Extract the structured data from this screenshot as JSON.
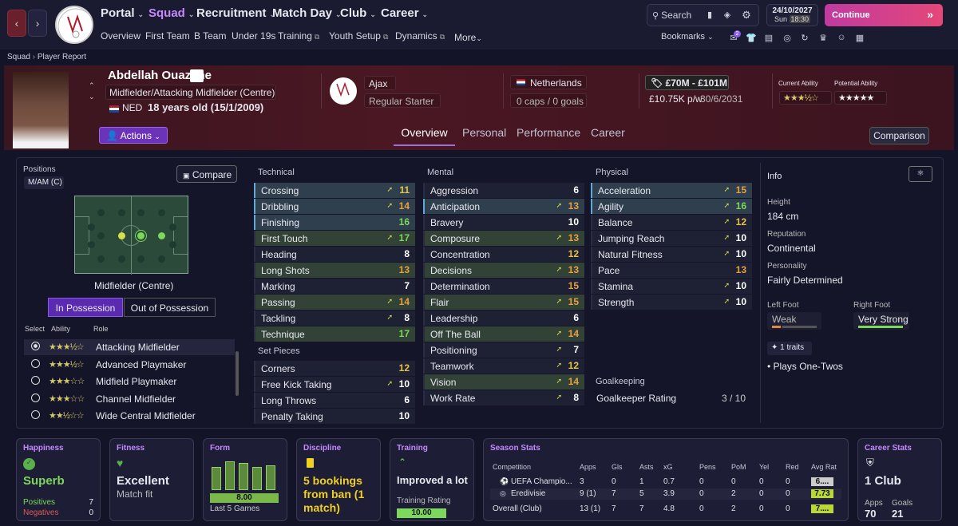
{
  "topbar": {
    "menus": [
      "Portal",
      "Squad",
      "Recruitment",
      "Match Day",
      "Club",
      "Career"
    ],
    "submenus": [
      "Overview",
      "First Team",
      "B Team",
      "Under 19s",
      "Training",
      "Youth Setup",
      "Dynamics",
      "More"
    ],
    "search": "Search",
    "date": "24/10/2027",
    "day_time": "Sun",
    "time": "18:30",
    "continue": "Continue",
    "bookmarks": "Bookmarks",
    "badge": "2"
  },
  "crumb": {
    "root": "Squad",
    "page": "Player Report"
  },
  "player": {
    "name": "Abdellah Ouazane",
    "position": "Midfielder/Attacking Midfielder (Centre)",
    "nation": "NED",
    "age": "18 years old (15/1/2009)",
    "club": "Ajax",
    "status": "Regular Starter",
    "country": "Netherlands",
    "caps": "0 caps / 0 goals",
    "value": "£70M - £101M",
    "wage": "£10.75K p/w",
    "contract": "30/6/2031",
    "ca_label": "Current Ability",
    "pa_label": "Potential Ability",
    "ca_stars": "★★★½☆",
    "pa_stars": "★★★★★",
    "actions": "Actions"
  },
  "tabs": [
    "Overview",
    "Personal",
    "Performance",
    "Career"
  ],
  "comparison": "Comparison",
  "positions": {
    "label": "Positions",
    "value": "M/AM (C)",
    "compare": "Compare",
    "role_name": "Midfielder (Centre)",
    "in_poss": "In Possession",
    "out_poss": "Out of Possession",
    "col_select": "Select",
    "col_ability": "Ability",
    "col_role": "Role",
    "roles": [
      {
        "stars": "★★★½☆",
        "name": "Attacking Midfielder"
      },
      {
        "stars": "★★★½☆",
        "name": "Advanced Playmaker"
      },
      {
        "stars": "★★★☆☆",
        "name": "Midfield Playmaker"
      },
      {
        "stars": "★★★☆☆",
        "name": "Channel Midfielder"
      },
      {
        "stars": "★★½☆☆",
        "name": "Wide Central Midfielder"
      }
    ]
  },
  "technical": {
    "title": "Technical",
    "items": [
      {
        "n": "Crossing",
        "v": "11",
        "c": "y",
        "s": "hl",
        "a": true
      },
      {
        "n": "Dribbling",
        "v": "14",
        "c": "o",
        "s": "hl",
        "a": true
      },
      {
        "n": "Finishing",
        "v": "16",
        "c": "g",
        "s": "hl",
        "a": false
      },
      {
        "n": "First Touch",
        "v": "17",
        "c": "g",
        "s": "gn",
        "a": true
      },
      {
        "n": "Heading",
        "v": "8",
        "c": "w",
        "s": "",
        "a": false
      },
      {
        "n": "Long Shots",
        "v": "13",
        "c": "o",
        "s": "gn",
        "a": false
      },
      {
        "n": "Marking",
        "v": "7",
        "c": "w",
        "s": "",
        "a": false
      },
      {
        "n": "Passing",
        "v": "14",
        "c": "o",
        "s": "gn",
        "a": true
      },
      {
        "n": "Tackling",
        "v": "8",
        "c": "w",
        "s": "",
        "a": true
      },
      {
        "n": "Technique",
        "v": "17",
        "c": "g",
        "s": "gn",
        "a": false
      }
    ]
  },
  "setpieces": {
    "title": "Set Pieces",
    "items": [
      {
        "n": "Corners",
        "v": "12",
        "c": "y",
        "s": "",
        "a": false
      },
      {
        "n": "Free Kick Taking",
        "v": "10",
        "c": "w",
        "s": "",
        "a": true
      },
      {
        "n": "Long Throws",
        "v": "6",
        "c": "w",
        "s": "",
        "a": false
      },
      {
        "n": "Penalty Taking",
        "v": "10",
        "c": "w",
        "s": "",
        "a": false
      }
    ]
  },
  "mental": {
    "title": "Mental",
    "items": [
      {
        "n": "Aggression",
        "v": "6",
        "c": "w",
        "s": "",
        "a": false
      },
      {
        "n": "Anticipation",
        "v": "13",
        "c": "o",
        "s": "hl",
        "a": true
      },
      {
        "n": "Bravery",
        "v": "10",
        "c": "w",
        "s": "",
        "a": false
      },
      {
        "n": "Composure",
        "v": "13",
        "c": "o",
        "s": "gn",
        "a": true
      },
      {
        "n": "Concentration",
        "v": "12",
        "c": "y",
        "s": "",
        "a": false
      },
      {
        "n": "Decisions",
        "v": "13",
        "c": "o",
        "s": "gn",
        "a": true
      },
      {
        "n": "Determination",
        "v": "15",
        "c": "o",
        "s": "",
        "a": false
      },
      {
        "n": "Flair",
        "v": "15",
        "c": "o",
        "s": "gn",
        "a": true
      },
      {
        "n": "Leadership",
        "v": "6",
        "c": "w",
        "s": "",
        "a": false
      },
      {
        "n": "Off The Ball",
        "v": "14",
        "c": "o",
        "s": "gn",
        "a": true
      },
      {
        "n": "Positioning",
        "v": "7",
        "c": "w",
        "s": "",
        "a": true
      },
      {
        "n": "Teamwork",
        "v": "12",
        "c": "y",
        "s": "",
        "a": true
      },
      {
        "n": "Vision",
        "v": "14",
        "c": "o",
        "s": "gn",
        "a": true
      },
      {
        "n": "Work Rate",
        "v": "8",
        "c": "w",
        "s": "",
        "a": true
      }
    ]
  },
  "physical": {
    "title": "Physical",
    "items": [
      {
        "n": "Acceleration",
        "v": "15",
        "c": "o",
        "s": "hl",
        "a": true
      },
      {
        "n": "Agility",
        "v": "16",
        "c": "g",
        "s": "hl",
        "a": true
      },
      {
        "n": "Balance",
        "v": "12",
        "c": "y",
        "s": "",
        "a": true
      },
      {
        "n": "Jumping Reach",
        "v": "10",
        "c": "w",
        "s": "",
        "a": true
      },
      {
        "n": "Natural Fitness",
        "v": "10",
        "c": "w",
        "s": "",
        "a": true
      },
      {
        "n": "Pace",
        "v": "13",
        "c": "o",
        "s": "",
        "a": false
      },
      {
        "n": "Stamina",
        "v": "10",
        "c": "w",
        "s": "",
        "a": true
      },
      {
        "n": "Strength",
        "v": "10",
        "c": "w",
        "s": "",
        "a": true
      }
    ]
  },
  "goalkeeping": {
    "title": "Goalkeeping",
    "label": "Goalkeeper Rating",
    "value": "3 / 10"
  },
  "info": {
    "title": "Info",
    "height_label": "Height",
    "height": "184 cm",
    "rep_label": "Reputation",
    "rep": "Continental",
    "pers_label": "Personality",
    "pers": "Fairly Determined",
    "lf_label": "Left Foot",
    "lf": "Weak",
    "rf_label": "Right Foot",
    "rf": "Very Strong",
    "traits": "1 traits",
    "trait1": "Plays One-Twos"
  },
  "cards": {
    "happiness": {
      "title": "Happiness",
      "value": "Superb",
      "pos_label": "Positives",
      "pos": "7",
      "neg_label": "Negatives",
      "neg": "0"
    },
    "fitness": {
      "title": "Fitness",
      "value": "Excellent",
      "sub": "Match fit"
    },
    "form": {
      "title": "Form",
      "rating": "8.00",
      "sub": "Last 5 Games",
      "bars": [
        0.72,
        0.9,
        0.85,
        0.72,
        0.78
      ]
    },
    "discipline": {
      "title": "Discipline",
      "value": "5 bookings from ban (1 match)"
    },
    "training": {
      "title": "Training",
      "value": "Improved a lot",
      "sub": "Training Rating",
      "rating": "10.00"
    },
    "season": {
      "title": "Season Stats",
      "headers": [
        "Competition",
        "Apps",
        "Gls",
        "Asts",
        "xG",
        "Pens",
        "PoM",
        "Yel",
        "Red",
        "Avg Rat"
      ],
      "rows": [
        [
          "UEFA Champio...",
          "3",
          "0",
          "1",
          "0.7",
          "0",
          "0",
          "0",
          "0",
          "6...."
        ],
        [
          "Eredivisie",
          "9 (1)",
          "7",
          "5",
          "3.9",
          "0",
          "2",
          "0",
          "0",
          "7.73"
        ],
        [
          "Overall (Club)",
          "13 (1)",
          "7",
          "7",
          "4.8",
          "0",
          "2",
          "0",
          "0",
          "7...."
        ]
      ]
    },
    "career": {
      "title": "Career Stats",
      "clubs": "1 Club",
      "apps_label": "Apps",
      "apps": "70",
      "goals_label": "Goals",
      "goals": "21"
    }
  }
}
